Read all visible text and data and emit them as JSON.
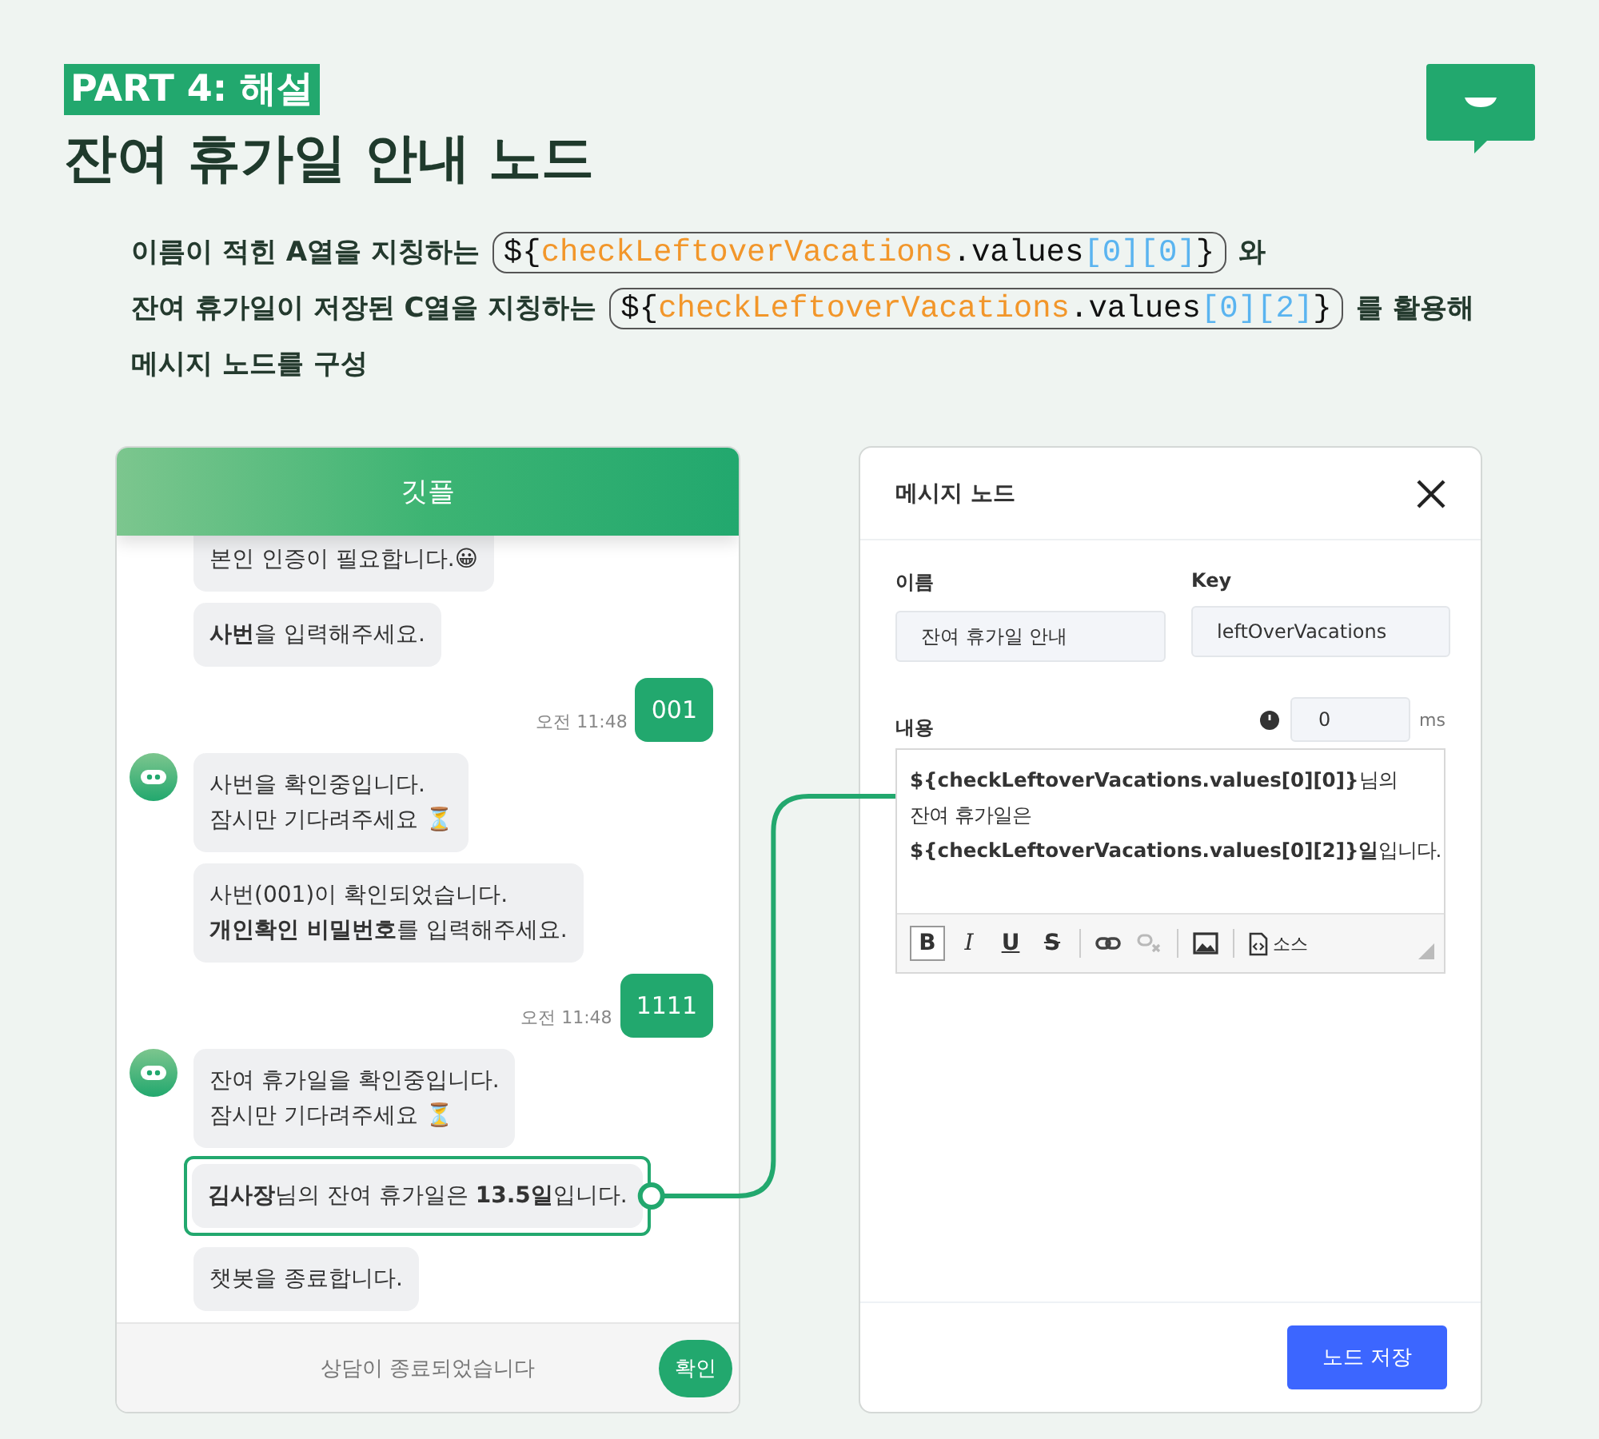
{
  "header": {
    "part_label": "PART 4: 해설",
    "title": "잔여 휴가일 안내 노드"
  },
  "description": {
    "lines": [
      {
        "segments": [
          {
            "kind": "text",
            "text": "이름이 적힌 A열을 지칭하는"
          },
          {
            "kind": "code",
            "tokens": [
              {
                "kind": "punct",
                "text": "${"
              },
              {
                "kind": "variable",
                "text": "checkLeftoverVacations"
              },
              {
                "kind": "punct",
                "text": ".values"
              },
              {
                "kind": "index",
                "text": "[0][0]"
              },
              {
                "kind": "punct",
                "text": "}"
              }
            ]
          },
          {
            "kind": "text",
            "text": "와"
          }
        ]
      },
      {
        "segments": [
          {
            "kind": "text",
            "text": "잔여 휴가일이 저장된 C열을 지칭하는"
          },
          {
            "kind": "code",
            "tokens": [
              {
                "kind": "punct",
                "text": "${"
              },
              {
                "kind": "variable",
                "text": "checkLeftoverVacations"
              },
              {
                "kind": "punct",
                "text": ".values"
              },
              {
                "kind": "index",
                "text": "[0][2]"
              },
              {
                "kind": "punct",
                "text": "}"
              }
            ]
          },
          {
            "kind": "text",
            "text": "를  활용해"
          }
        ]
      },
      {
        "segments": [
          {
            "kind": "text",
            "text": "메시지 노드를 구성"
          }
        ]
      }
    ]
  },
  "chat": {
    "title": "깃플",
    "messages": [
      {
        "kind": "bot",
        "avatar": false,
        "highlighted": false,
        "text": "본인 인증이 필요합니다.😀"
      },
      {
        "kind": "bot",
        "avatar": false,
        "highlighted": false,
        "text": "**사번**을 입력해주세요."
      },
      {
        "kind": "user",
        "text": "001",
        "time": "오전 11:48"
      },
      {
        "kind": "bot",
        "avatar": true,
        "highlighted": false,
        "text": "사번을 확인중입니다.\n잠시만 기다려주세요 ⏳"
      },
      {
        "kind": "bot",
        "avatar": false,
        "highlighted": false,
        "text": "사번(001)이 확인되었습니다.\n**개인확인 비밀번호**를 입력해주세요."
      },
      {
        "kind": "user",
        "text": "1111",
        "time": "오전 11:48"
      },
      {
        "kind": "bot",
        "avatar": true,
        "highlighted": false,
        "text": "잔여 휴가일을 확인중입니다.\n잠시만 기다려주세요 ⏳"
      },
      {
        "kind": "bot",
        "avatar": false,
        "highlighted": true,
        "text": "**김사장**님의 잔여 휴가일은 **13.5일**입니다."
      },
      {
        "kind": "bot",
        "avatar": false,
        "highlighted": false,
        "text": "챗봇을 종료합니다."
      }
    ],
    "footer_text": "상담이 종료되었습니다",
    "confirm_button": "확인"
  },
  "dialog": {
    "title": "메시지 노드",
    "fields": [
      {
        "label": "이름",
        "value": "잔여 휴가일 안내"
      },
      {
        "label": "Key",
        "value": "leftOverVacations"
      }
    ],
    "content_label": "내용",
    "delay": {
      "value": "0",
      "unit": "ms"
    },
    "editor_lines": [
      "**${checkLeftoverVacations.values[0][0]}**님의",
      "잔여 휴가일은",
      "**${checkLeftoverVacations.values[0][2]}일**입니다."
    ],
    "toolbar": [
      {
        "kind": "bold",
        "label": "B",
        "selected": true,
        "disabled": false
      },
      {
        "kind": "italic",
        "label": "I",
        "selected": false,
        "disabled": false
      },
      {
        "kind": "underline",
        "label": "U",
        "selected": false,
        "disabled": false
      },
      {
        "kind": "strike",
        "label": "S",
        "selected": false,
        "disabled": false
      },
      {
        "kind": "link",
        "selected": false,
        "disabled": false
      },
      {
        "kind": "unlink",
        "selected": false,
        "disabled": true
      },
      {
        "kind": "image",
        "selected": false,
        "disabled": false
      },
      {
        "kind": "source",
        "label": "소스",
        "selected": false,
        "disabled": false
      }
    ],
    "save_button": "노드 저장"
  }
}
